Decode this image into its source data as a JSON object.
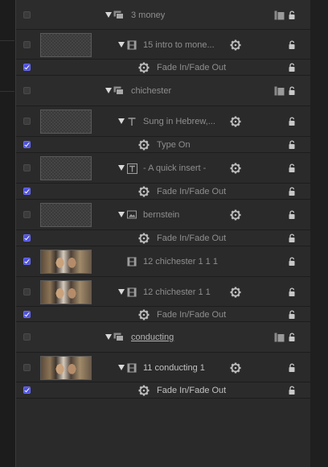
{
  "layers": [
    {
      "kind": "group",
      "label": "3 money",
      "checked": false,
      "expanded": true
    },
    {
      "kind": "layer",
      "label": "15 intro to mone...",
      "checked": false,
      "thumb": "checker",
      "type_icon": "film-icon",
      "gear": true,
      "expanded": true
    },
    {
      "kind": "behavior",
      "label": "Fade In/Fade Out",
      "checked": true
    },
    {
      "kind": "group",
      "label": "chichester",
      "checked": false,
      "expanded": true
    },
    {
      "kind": "layer",
      "label": "Sung in Hebrew,...",
      "checked": false,
      "thumb": "checker",
      "type_icon": "text-icon",
      "gear": true,
      "expanded": true
    },
    {
      "kind": "behavior",
      "label": "Type On",
      "checked": true
    },
    {
      "kind": "layer",
      "label": "- A quick insert -",
      "checked": false,
      "thumb": "checker",
      "type_icon": "text-box-icon",
      "gear": true,
      "expanded": true
    },
    {
      "kind": "behavior",
      "label": "Fade In/Fade Out",
      "checked": true
    },
    {
      "kind": "layer",
      "label": "bernstein",
      "checked": false,
      "thumb": "checker",
      "type_icon": "image-icon",
      "gear": true,
      "expanded": true
    },
    {
      "kind": "behavior",
      "label": "Fade In/Fade Out",
      "checked": true
    },
    {
      "kind": "layer",
      "label": "12 chichester 1 1 1",
      "checked": true,
      "thumb": "video",
      "type_icon": "film-icon",
      "gear": false,
      "expanded": false
    },
    {
      "kind": "layer",
      "label": "12 chichester 1 1",
      "checked": false,
      "thumb": "video",
      "type_icon": "film-icon",
      "gear": true,
      "expanded": true
    },
    {
      "kind": "behavior",
      "label": "Fade In/Fade Out",
      "checked": true
    },
    {
      "kind": "group",
      "label": "conducting",
      "checked": false,
      "expanded": true,
      "underline": true
    },
    {
      "kind": "layer",
      "label": "11 conducting 1",
      "checked": false,
      "thumb": "video",
      "type_icon": "film-icon",
      "gear": true,
      "expanded": true,
      "bright": true
    },
    {
      "kind": "behavior",
      "label": "Fade In/Fade Out",
      "checked": true,
      "bright": true
    }
  ],
  "colors": {
    "checkbox_on": "#4f52d9",
    "panel_bg": "#2a2a2b",
    "text": "#8e8e8e"
  }
}
